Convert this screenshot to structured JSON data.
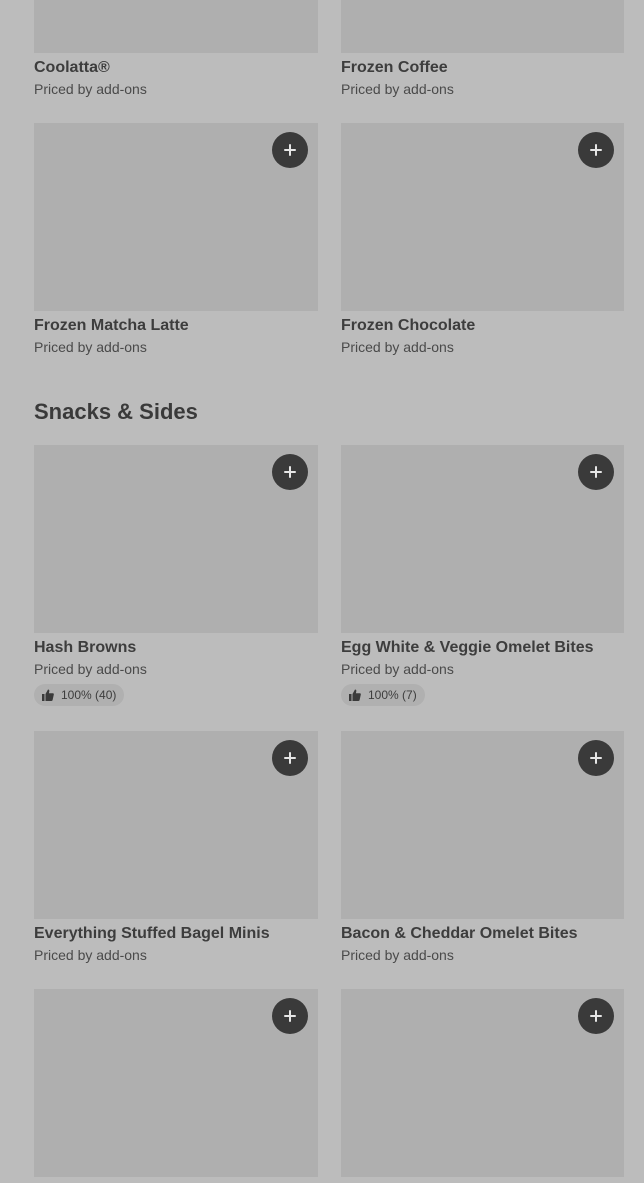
{
  "rows": [
    {
      "items": [
        {
          "title": "Coolatta®",
          "subtitle": "Priced by add-ons"
        },
        {
          "title": "Frozen Coffee",
          "subtitle": "Priced by add-ons"
        }
      ]
    },
    {
      "items": [
        {
          "title": "Frozen Matcha Latte",
          "subtitle": "Priced by add-ons"
        },
        {
          "title": "Frozen Chocolate",
          "subtitle": "Priced by add-ons"
        }
      ]
    }
  ],
  "section": {
    "title": "Snacks & Sides"
  },
  "snacks": [
    {
      "items": [
        {
          "title": "Hash Browns",
          "subtitle": "Priced by add-ons",
          "rating": "100% (40)"
        },
        {
          "title": "Egg White & Veggie Omelet Bites",
          "subtitle": "Priced by add-ons",
          "rating": "100% (7)"
        }
      ]
    },
    {
      "items": [
        {
          "title": "Everything Stuffed Bagel Minis",
          "subtitle": "Priced by add-ons"
        },
        {
          "title": "Bacon & Cheddar Omelet Bites",
          "subtitle": "Priced by add-ons"
        }
      ]
    }
  ],
  "icons": {
    "add": "plus-icon",
    "rating": "thumbs-up-icon"
  },
  "colors": {
    "background": "#bcbcbc",
    "image_placeholder": "#afafaf",
    "button": "#3a3a3a"
  }
}
